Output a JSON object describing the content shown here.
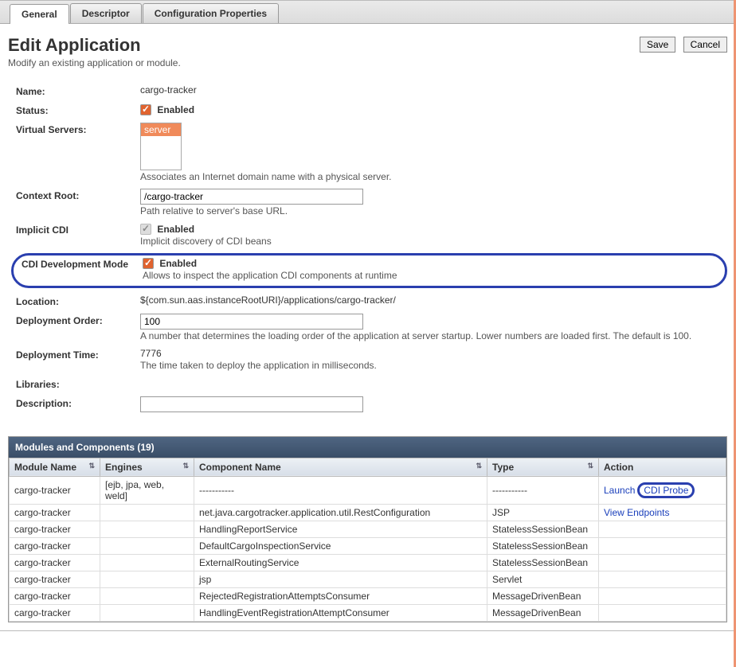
{
  "tabs": {
    "general": "General",
    "descriptor": "Descriptor",
    "config": "Configuration Properties"
  },
  "title": "Edit Application",
  "subtitle": "Modify an existing application or module.",
  "buttons": {
    "save": "Save",
    "cancel": "Cancel"
  },
  "fields": {
    "name_label": "Name:",
    "name_value": "cargo-tracker",
    "status_label": "Status:",
    "status_value": "Enabled",
    "virtual_servers_label": "Virtual Servers:",
    "virtual_servers_item": "server",
    "virtual_servers_hint": "Associates an Internet domain name with a physical server.",
    "context_root_label": "Context Root:",
    "context_root_value": "/cargo-tracker",
    "context_root_hint": "Path relative to server's base URL.",
    "implicit_cdi_label": "Implicit CDI",
    "implicit_cdi_value": "Enabled",
    "implicit_cdi_hint": "Implicit discovery of CDI beans",
    "cdi_dev_label": "CDI Development Mode",
    "cdi_dev_value": "Enabled",
    "cdi_dev_hint": "Allows to inspect the application CDI components at runtime",
    "location_label": "Location:",
    "location_value": "${com.sun.aas.instanceRootURI}/applications/cargo-tracker/",
    "deploy_order_label": "Deployment Order:",
    "deploy_order_value": "100",
    "deploy_order_hint": "A number that determines the loading order of the application at server startup. Lower numbers are loaded first. The default is 100.",
    "deploy_time_label": "Deployment Time:",
    "deploy_time_value": "7776",
    "deploy_time_hint": "The time taken to deploy the application in milliseconds.",
    "libraries_label": "Libraries:",
    "description_label": "Description:",
    "description_value": ""
  },
  "table": {
    "title": "Modules and Components (19)",
    "headers": {
      "module": "Module Name",
      "engines": "Engines",
      "component": "Component Name",
      "type": "Type",
      "action": "Action"
    },
    "rows": [
      {
        "module": "cargo-tracker",
        "engines": "[ejb, jpa, web, weld]",
        "component": "-----------",
        "type": "-----------",
        "actions": [
          "Launch",
          "CDI Probe"
        ]
      },
      {
        "module": "cargo-tracker",
        "engines": "",
        "component": "net.java.cargotracker.application.util.RestConfiguration",
        "type": "JSP",
        "actions": [
          "View Endpoints"
        ]
      },
      {
        "module": "cargo-tracker",
        "engines": "",
        "component": "HandlingReportService",
        "type": "StatelessSessionBean",
        "actions": []
      },
      {
        "module": "cargo-tracker",
        "engines": "",
        "component": "DefaultCargoInspectionService",
        "type": "StatelessSessionBean",
        "actions": []
      },
      {
        "module": "cargo-tracker",
        "engines": "",
        "component": "ExternalRoutingService",
        "type": "StatelessSessionBean",
        "actions": []
      },
      {
        "module": "cargo-tracker",
        "engines": "",
        "component": "jsp",
        "type": "Servlet",
        "actions": []
      },
      {
        "module": "cargo-tracker",
        "engines": "",
        "component": "RejectedRegistrationAttemptsConsumer",
        "type": "MessageDrivenBean",
        "actions": []
      },
      {
        "module": "cargo-tracker",
        "engines": "",
        "component": "HandlingEventRegistrationAttemptConsumer",
        "type": "MessageDrivenBean",
        "actions": []
      }
    ]
  }
}
